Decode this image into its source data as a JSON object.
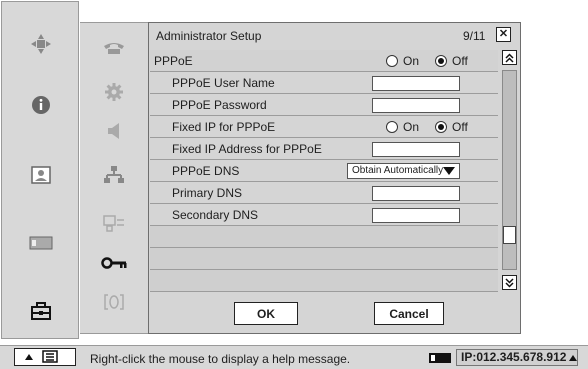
{
  "window": {
    "title": "Administrator Setup",
    "page": "9/11",
    "close_glyph": "✕"
  },
  "left_nav": [
    {
      "icon": "camera-pan-icon"
    },
    {
      "icon": "info-icon"
    },
    {
      "icon": "picture-icon"
    },
    {
      "icon": "battery-card-icon"
    },
    {
      "icon": "toolbox-icon"
    }
  ],
  "menu_icons": [
    {
      "icon": "phone-icon"
    },
    {
      "icon": "gear-icon"
    },
    {
      "icon": "speaker-icon"
    },
    {
      "icon": "network-icon"
    },
    {
      "icon": "display-switch-icon"
    },
    {
      "icon": "key-icon"
    },
    {
      "icon": "bracket-icon"
    }
  ],
  "settings": {
    "pppoe": {
      "label": "PPPoE",
      "on_label": "On",
      "off_label": "Off",
      "selected": "Off"
    },
    "user_name": {
      "label": "PPPoE User Name",
      "value": ""
    },
    "password": {
      "label": "PPPoE Password",
      "value": ""
    },
    "fixed_ip": {
      "label": "Fixed IP for PPPoE",
      "on_label": "On",
      "off_label": "Off",
      "selected": "Off"
    },
    "fixed_ip_address": {
      "label": "Fixed IP Address for PPPoE",
      "value": ""
    },
    "dns": {
      "label": "PPPoE DNS",
      "value": "Obtain Automatically"
    },
    "primary_dns": {
      "label": "Primary DNS",
      "value": ""
    },
    "secondary_dns": {
      "label": "Secondary DNS",
      "value": ""
    }
  },
  "buttons": {
    "ok": "OK",
    "cancel": "Cancel"
  },
  "status": {
    "help_text": "Right-click the mouse to display a help message.",
    "ip": "IP:012.345.678.912"
  },
  "colors": {
    "panel_bg": "#d5d5d5",
    "bar_bg": "#d8d8d8",
    "input_bg": "#ffffff"
  }
}
